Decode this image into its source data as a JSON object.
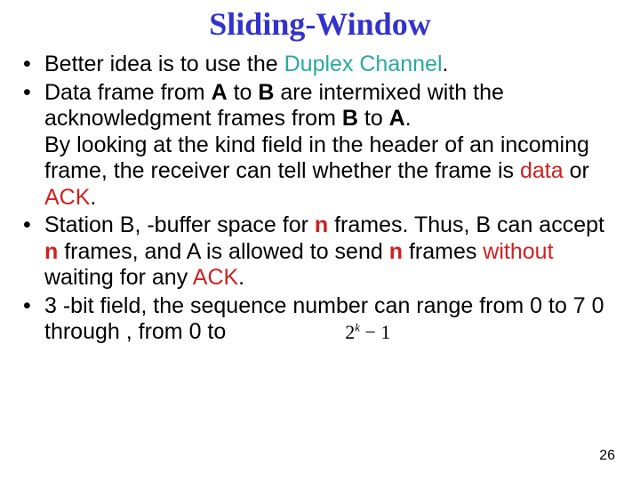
{
  "title": "Sliding-Window",
  "bullets": {
    "b1": {
      "pre": "Better idea is to use the ",
      "duplex": "Duplex Channel",
      "post": "."
    },
    "b2": {
      "t1": "Data frame from ",
      "A": "A",
      "t2": " to ",
      "B": "B",
      "t3": " are intermixed with the acknowledgment frames from ",
      "B2": "B",
      "t4": " to ",
      "A2": "A",
      "t5": "."
    },
    "b2cont": {
      "t1": "By looking at the kind field in the header of an incoming frame, the receiver can tell whether the frame is ",
      "data": "data",
      "t2": " or ",
      "ack": "ACK",
      "t3": "."
    },
    "b3": {
      "t1": "Station B, -buffer space for ",
      "n1": "n",
      "t2": " frames. Thus, B can accept ",
      "n2": "n",
      "t3": " frames, and A is allowed to send ",
      "n3": "n",
      "t4": " frames ",
      "without": "without",
      "t5": " waiting for any ",
      "ack": "ACK",
      "t6": "."
    },
    "b4": {
      "t1": "3 -bit field, the sequence number can range from 0 to 7 0 through , from 0 to",
      "formula_base": "2",
      "formula_exp": "k",
      "formula_tail": " − 1"
    }
  },
  "page": "26"
}
